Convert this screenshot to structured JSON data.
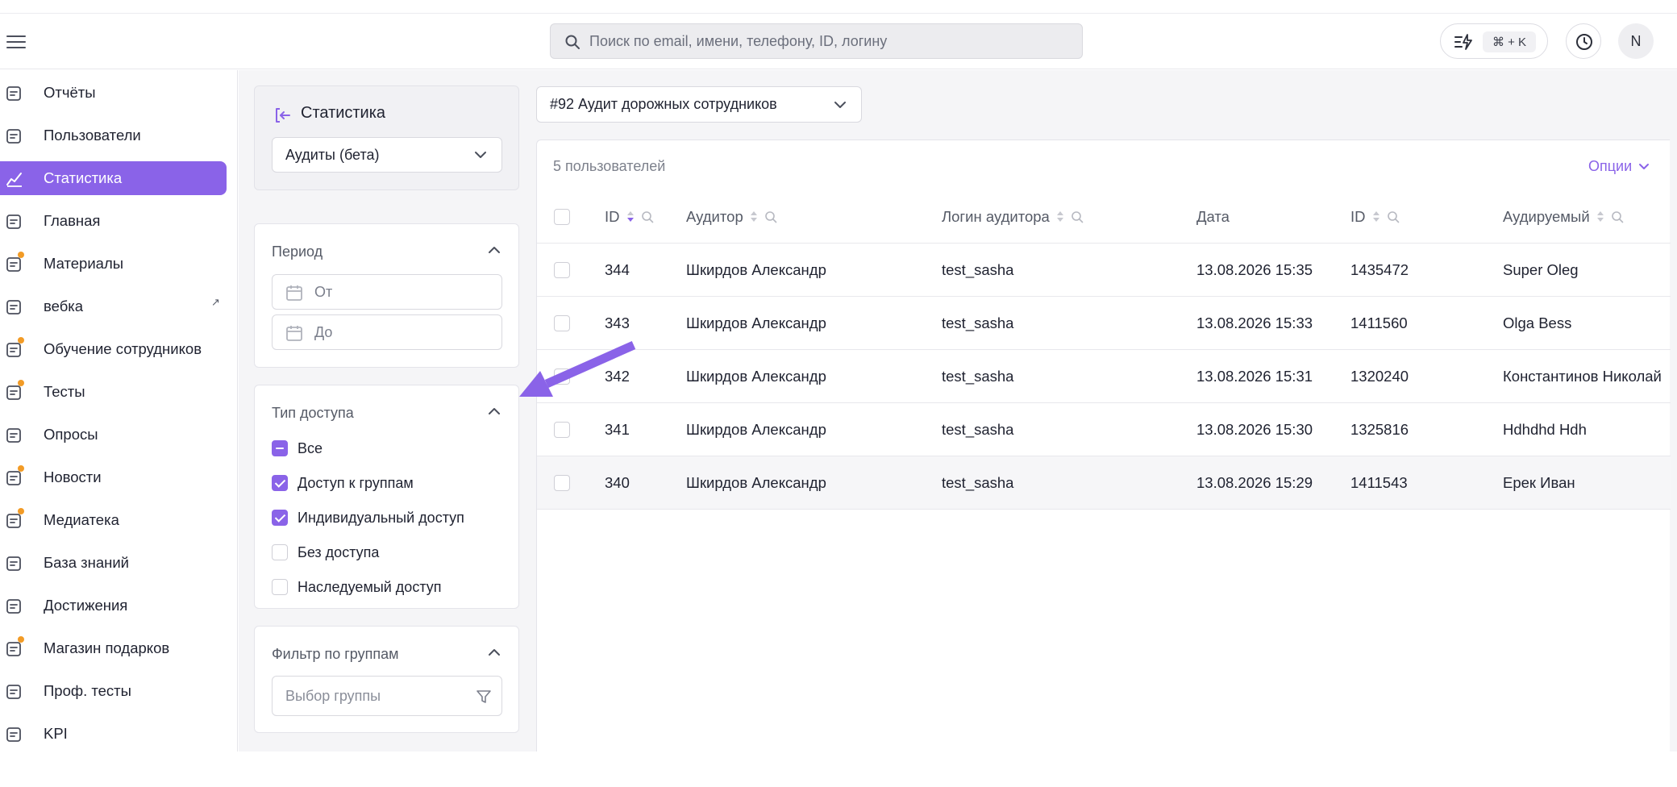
{
  "header": {
    "search_placeholder": "Поиск по email, имени, телефону, ID, логину",
    "shortcut": "⌘ + K",
    "avatar_initial": "N"
  },
  "sidebar": {
    "items": [
      {
        "label": "Отчёты",
        "icon": "reports-icon"
      },
      {
        "label": "Пользователи",
        "icon": "users-icon"
      },
      {
        "label": "Статистика",
        "icon": "chart-icon",
        "active": true
      },
      {
        "label": "Главная",
        "icon": "home-icon"
      },
      {
        "label": "Материалы",
        "icon": "materials-icon"
      },
      {
        "label": "вебка",
        "icon": "external-link-icon",
        "external": "↗"
      },
      {
        "label": "Обучение сотрудников",
        "icon": "training-icon"
      },
      {
        "label": "Тесты",
        "icon": "tests-icon"
      },
      {
        "label": "Опросы",
        "icon": "survey-icon"
      },
      {
        "label": "Новости",
        "icon": "news-icon"
      },
      {
        "label": "Медиатека",
        "icon": "media-icon"
      },
      {
        "label": "База знаний",
        "icon": "knowledge-base-icon"
      },
      {
        "label": "Достижения",
        "icon": "trophy-icon"
      },
      {
        "label": "Магазин подарков",
        "icon": "gift-icon"
      },
      {
        "label": "Проф. тесты",
        "icon": "prof-tests-icon"
      },
      {
        "label": "KPI",
        "icon": "kpi-icon"
      }
    ]
  },
  "stat_panel": {
    "title": "Статистика",
    "section_value": "Аудиты (бета)"
  },
  "period": {
    "title": "Период",
    "from_placeholder": "От",
    "to_placeholder": "До"
  },
  "access": {
    "title": "Тип доступа",
    "options": [
      {
        "label": "Все",
        "state": "indeterminate"
      },
      {
        "label": "Доступ к группам",
        "state": "checked"
      },
      {
        "label": "Индивидуальный доступ",
        "state": "checked"
      },
      {
        "label": "Без доступа",
        "state": "unchecked"
      },
      {
        "label": "Наследуемый доступ",
        "state": "unchecked"
      }
    ]
  },
  "group_filter": {
    "title": "Фильтр по группам",
    "placeholder": "Выбор группы"
  },
  "audit_select": {
    "value": "#92 Аудит дорожных сотрудников"
  },
  "table": {
    "count_label": "5 пользователей",
    "options_label": "Опции",
    "columns": [
      "ID",
      "Аудитор",
      "Логин аудитора",
      "Дата",
      "ID",
      "Аудируемый"
    ],
    "rows": [
      [
        "344",
        "Шкирдов Александр",
        "test_sasha",
        "13.08.2026 15:35",
        "1435472",
        "Super Oleg"
      ],
      [
        "343",
        "Шкирдов Александр",
        "test_sasha",
        "13.08.2026 15:33",
        "1411560",
        "Olga Bess"
      ],
      [
        "342",
        "Шкирдов Александр",
        "test_sasha",
        "13.08.2026 15:31",
        "1320240",
        "Константинов Николай"
      ],
      [
        "341",
        "Шкирдов Александр",
        "test_sasha",
        "13.08.2026 15:30",
        "1325816",
        "Hdhdhd Hdh"
      ],
      [
        "340",
        "Шкирдов Александр",
        "test_sasha",
        "13.08.2026 15:29",
        "1411543",
        "Ерек Иван"
      ]
    ]
  },
  "colors": {
    "accent": "#8a63e8",
    "dot": "#f29b26"
  }
}
